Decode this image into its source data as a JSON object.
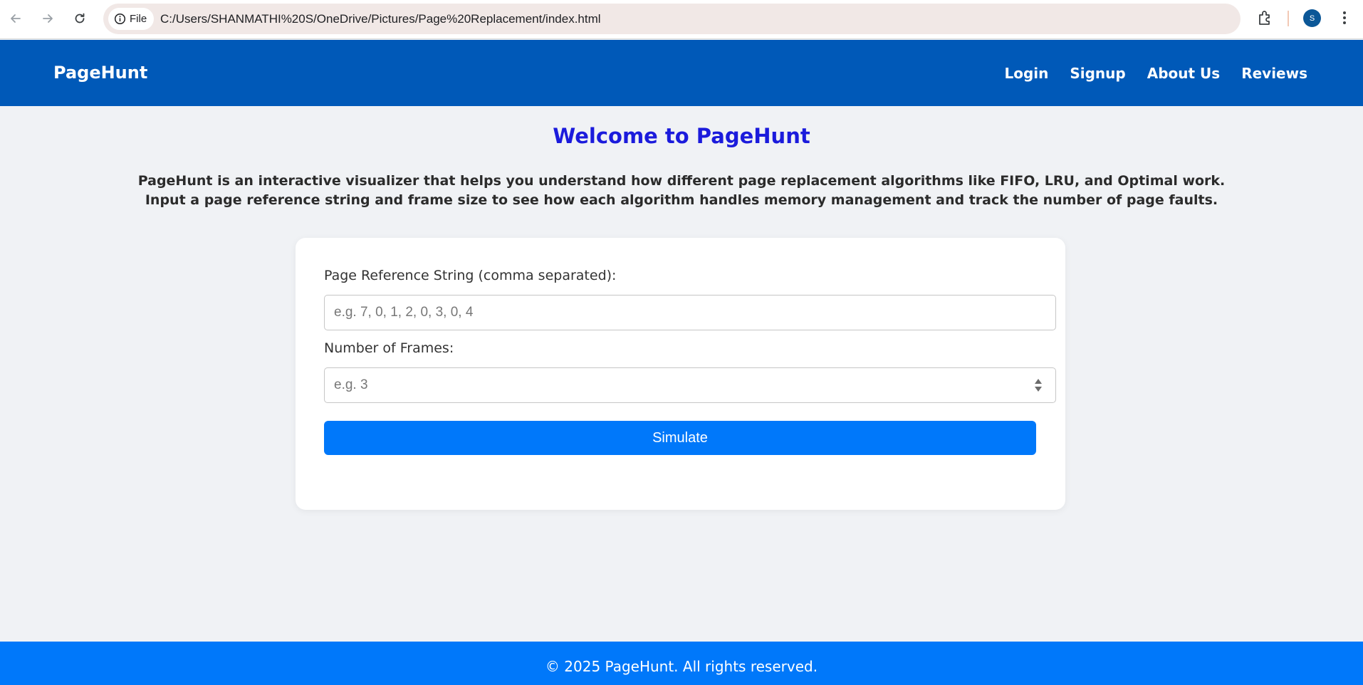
{
  "browser": {
    "site_chip_label": "File",
    "url": "C:/Users/SHANMATHI%20S/OneDrive/Pictures/Page%20Replacement/index.html",
    "avatar_initial": "S"
  },
  "header": {
    "logo": "PageHunt",
    "nav": [
      "Login",
      "Signup",
      "About Us",
      "Reviews"
    ]
  },
  "main": {
    "title": "Welcome to PageHunt",
    "intro_line1": "PageHunt is an interactive visualizer that helps you understand how different page replacement algorithms like FIFO, LRU, and Optimal work.",
    "intro_line2": "Input a page reference string and frame size to see how each algorithm handles memory management and track the number of page faults.",
    "form": {
      "reference_label": "Page Reference String (comma separated):",
      "reference_placeholder": "e.g. 7, 0, 1, 2, 0, 3, 0, 4",
      "reference_value": "",
      "frames_label": "Number of Frames:",
      "frames_placeholder": "e.g. 3",
      "frames_value": "",
      "submit_label": "Simulate"
    }
  },
  "footer": {
    "text": "© 2025 PageHunt. All rights reserved."
  },
  "colors": {
    "header_bg": "#0059b8",
    "accent": "#0078fa",
    "title": "#1b1bdc",
    "page_bg": "#f0f2f5"
  },
  "icons": [
    "back-arrow-icon",
    "forward-arrow-icon",
    "reload-icon",
    "info-icon",
    "star-icon",
    "extensions-icon",
    "more-vert-icon"
  ]
}
